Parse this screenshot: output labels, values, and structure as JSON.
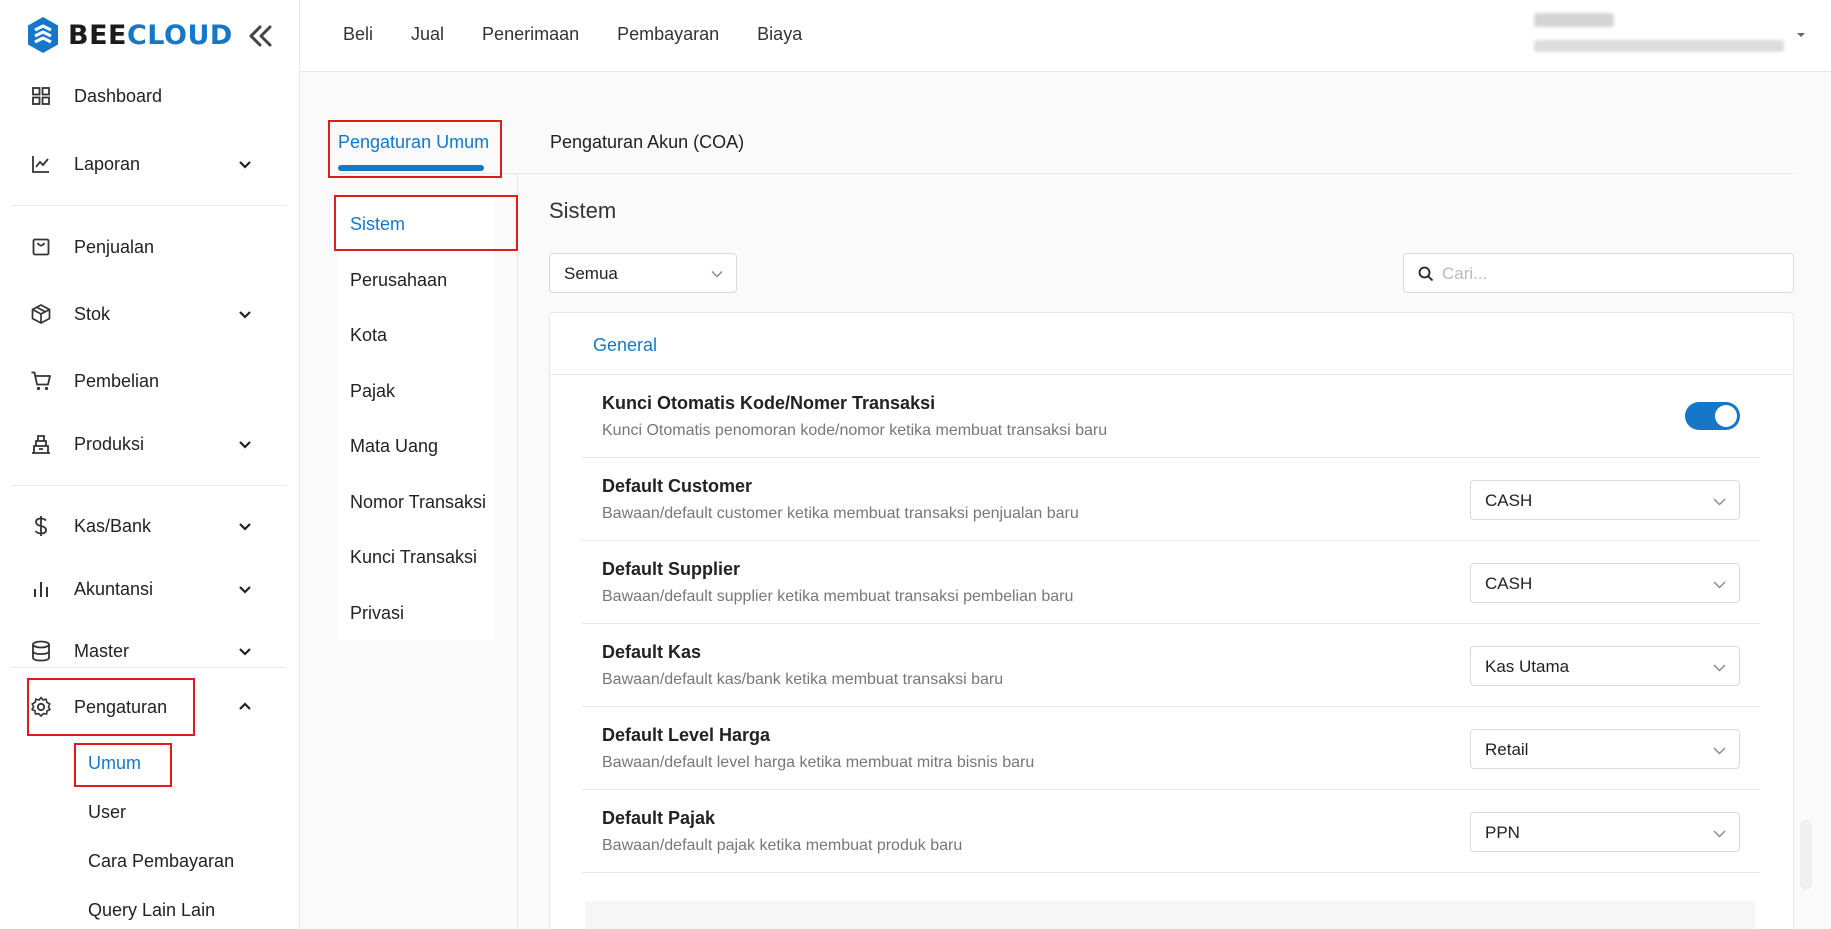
{
  "brand": {
    "part1": "BEE",
    "part2": "CLOUD"
  },
  "colors": {
    "accent": "#1677c8",
    "highlight": "#e01b1b"
  },
  "sidebar": {
    "items": [
      {
        "label": "Dashboard",
        "icon": "grid-icon"
      },
      {
        "label": "Laporan",
        "icon": "chart-line-icon"
      },
      {
        "label": "Penjualan",
        "icon": "shopping-bag-icon"
      },
      {
        "label": "Stok",
        "icon": "box-icon"
      },
      {
        "label": "Pembelian",
        "icon": "cart-icon"
      },
      {
        "label": "Produksi",
        "icon": "factory-icon"
      },
      {
        "label": "Kas/Bank",
        "icon": "dollar-icon"
      },
      {
        "label": "Akuntansi",
        "icon": "bar-chart-icon"
      },
      {
        "label": "Master",
        "icon": "database-icon"
      },
      {
        "label": "Pengaturan",
        "icon": "gear-icon"
      }
    ],
    "sub_items": [
      {
        "label": "Umum"
      },
      {
        "label": "User"
      },
      {
        "label": "Cara Pembayaran"
      },
      {
        "label": "Query Lain Lain"
      }
    ]
  },
  "topnav": [
    "Beli",
    "Jual",
    "Penerimaan",
    "Pembayaran",
    "Biaya"
  ],
  "tabs": [
    "Pengaturan Umum",
    "Pengaturan Akun (COA)"
  ],
  "submenu": [
    "Sistem",
    "Perusahaan",
    "Kota",
    "Pajak",
    "Mata Uang",
    "Nomor Transaksi",
    "Kunci Transaksi",
    "Privasi"
  ],
  "content": {
    "section_title": "Sistem",
    "filter_value": "Semua",
    "search_placeholder": "Cari...",
    "card_title": "General"
  },
  "settings": [
    {
      "title": "Kunci Otomatis Kode/Nomer Transaksi",
      "desc": "Kunci Otomatis penomoran kode/nomor ketika membuat transaksi baru",
      "toggle": true
    },
    {
      "title": "Default Customer",
      "desc": "Bawaan/default customer ketika membuat transaksi penjualan baru",
      "value": "CASH"
    },
    {
      "title": "Default Supplier",
      "desc": "Bawaan/default supplier ketika membuat transaksi pembelian baru",
      "value": "CASH"
    },
    {
      "title": "Default Kas",
      "desc": "Bawaan/default kas/bank ketika membuat transaksi baru",
      "value": "Kas Utama"
    },
    {
      "title": "Default Level Harga",
      "desc": "Bawaan/default level harga ketika membuat mitra bisnis baru",
      "value": "Retail"
    },
    {
      "title": "Default Pajak",
      "desc": "Bawaan/default pajak ketika membuat produk baru",
      "value": "PPN"
    }
  ]
}
